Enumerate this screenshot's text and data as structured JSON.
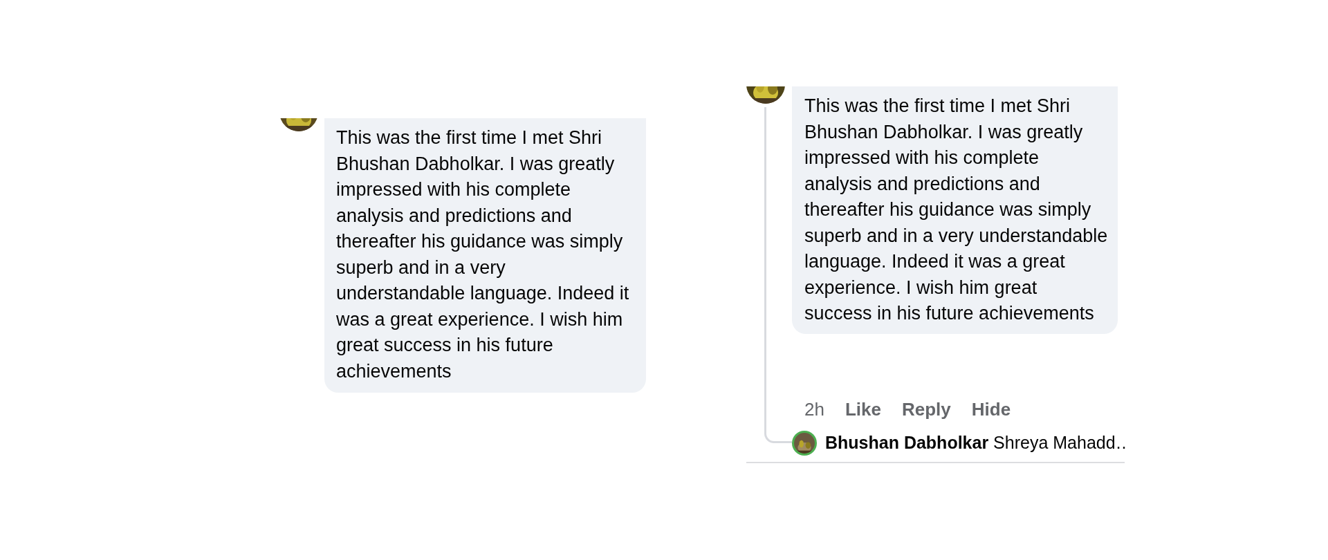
{
  "panels": [
    {
      "comment": {
        "text": "This was the first time I met Shri Bhushan Dabholkar. I was greatly impressed with his complete analysis and predictions and thereafter his guidance was simply superb and in a very understandable language. Indeed it was a great experience. I wish him great success in his future achievements"
      }
    },
    {
      "comment": {
        "text": "This was the first time I met Shri Bhushan Dabholkar. I was greatly impressed with his complete analysis and predictions and thereafter his guidance was simply superb and in a very understandable language. Indeed it was a great experience. I wish him great success in his future achievements"
      },
      "time": "2h",
      "actions": [
        "Like",
        "Reply",
        "Hide"
      ],
      "reply_preview": {
        "author": "Bhushan Dabholkar",
        "text": "Shreya Mahadd…"
      }
    }
  ]
}
